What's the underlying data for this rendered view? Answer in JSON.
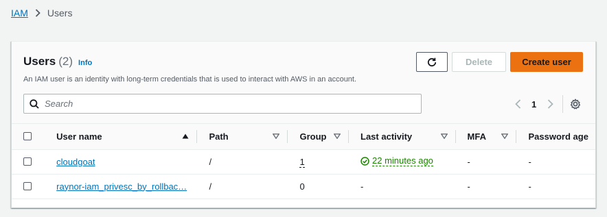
{
  "breadcrumb": {
    "root": "IAM",
    "current": "Users"
  },
  "header": {
    "title": "Users",
    "count": "(2)",
    "info": "Info",
    "description": "An IAM user is an identity with long-term credentials that is used to interact with AWS in an account."
  },
  "actions": {
    "refresh_icon": "refresh-icon",
    "delete_label": "Delete",
    "create_label": "Create user"
  },
  "search": {
    "placeholder": "Search",
    "value": ""
  },
  "pagination": {
    "current_page": "1"
  },
  "table": {
    "columns": [
      {
        "label": "User name",
        "sort": "ascending"
      },
      {
        "label": "Path",
        "sort": "none"
      },
      {
        "label": "Groups",
        "sort": "none"
      },
      {
        "label": "Last activity",
        "sort": "none"
      },
      {
        "label": "MFA",
        "sort": "none"
      },
      {
        "label": "Password age",
        "sort": "none"
      }
    ],
    "rows": [
      {
        "user_name": "cloudgoat",
        "path": "/",
        "groups": "1",
        "last_activity": "22 minutes ago",
        "mfa": "-",
        "password_age": "-"
      },
      {
        "user_name": "raynor-iam_privesc_by_rollbac…",
        "path": "/",
        "groups": "0",
        "last_activity": "-",
        "mfa": "-",
        "password_age": "-"
      }
    ]
  },
  "colors": {
    "link": "#0073bb",
    "primary": "#ec7211",
    "success": "#1d8102",
    "background": "#f2f3f3"
  }
}
